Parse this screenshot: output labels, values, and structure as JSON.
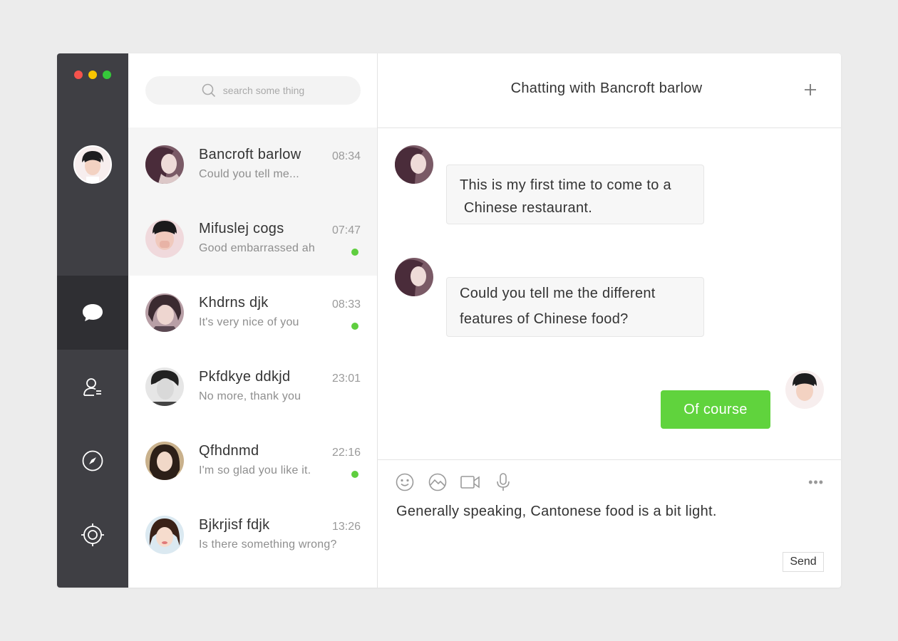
{
  "window": {
    "traffic_colors": [
      "#f5524c",
      "#f7c500",
      "#35c93a"
    ]
  },
  "rail": {
    "items": [
      {
        "icon": "chat-bubble-icon",
        "active": true
      },
      {
        "icon": "contacts-icon",
        "active": false
      },
      {
        "icon": "compass-icon",
        "active": false
      },
      {
        "icon": "settings-gear-icon",
        "active": false
      }
    ]
  },
  "search": {
    "placeholder": "search some thing"
  },
  "conversations": [
    {
      "name": "Bancroft barlow",
      "time": "08:34",
      "preview": "Could you tell me...",
      "unread": false,
      "selected": true
    },
    {
      "name": "Mifuslej cogs",
      "time": "07:47",
      "preview": "Good embarrassed ah",
      "unread": true,
      "selected": true
    },
    {
      "name": "Khdrns djk",
      "time": "08:33",
      "preview": "It's very nice of you",
      "unread": true,
      "selected": false
    },
    {
      "name": "Pkfdkye ddkjd",
      "time": "23:01",
      "preview": "No more, thank you",
      "unread": false,
      "selected": false
    },
    {
      "name": "Qfhdnmd",
      "time": "22:16",
      "preview": "I'm so glad you like it.",
      "unread": true,
      "selected": false
    },
    {
      "name": "Bjkrjisf fdjk",
      "time": "13:26",
      "preview": "Is there something wrong?",
      "unread": false,
      "selected": false
    }
  ],
  "chat": {
    "title": "Chatting with Bancroft barlow",
    "messages": [
      {
        "from": "them",
        "lines": [
          "This is my first time to come to a",
          " Chinese restaurant."
        ]
      },
      {
        "from": "them",
        "lines": [
          "Could you tell me the different",
          "features of Chinese food?"
        ]
      },
      {
        "from": "me",
        "lines": [
          "Of course"
        ]
      }
    ],
    "compose_text": "Generally speaking, Cantonese food is a bit light.",
    "send_label": "Send",
    "more_label": "•••",
    "accent": "#60d33d",
    "unread_dot": "#5fce3f"
  }
}
